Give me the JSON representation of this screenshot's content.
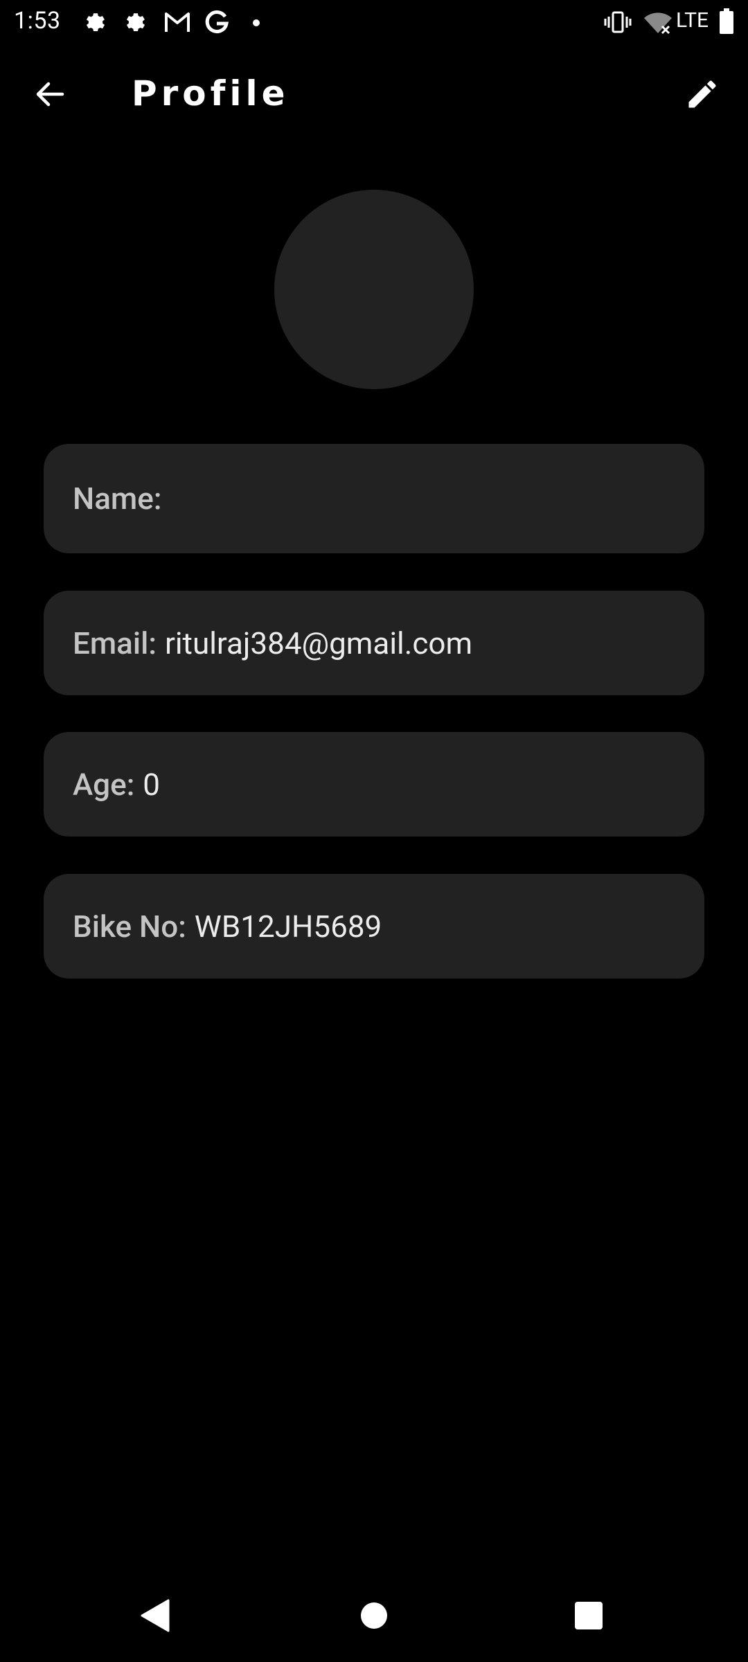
{
  "status_bar": {
    "time": "1:53",
    "network": "LTE",
    "icons": [
      "settings-icon",
      "settings-icon",
      "gmail-icon",
      "google-icon",
      "dot-icon",
      "vibrate-icon",
      "wifi-off-icon",
      "battery-icon"
    ]
  },
  "header": {
    "title": "Profile",
    "back_icon": "arrow-back-icon",
    "edit_icon": "pencil-icon"
  },
  "profile": {
    "fields": [
      {
        "label": "Name:",
        "value": ""
      },
      {
        "label": "Email:",
        "value": "ritulraj384@gmail.com"
      },
      {
        "label": "Age:",
        "value": "0"
      },
      {
        "label": "Bike No:",
        "value": "WB12JH5689"
      }
    ]
  },
  "nav_bar": {
    "icons": [
      "back-triangle-icon",
      "home-circle-icon",
      "recents-square-icon"
    ]
  },
  "colors": {
    "background": "#000000",
    "card": "#222222",
    "text": "#ffffff",
    "label": "#c4c4c4"
  }
}
